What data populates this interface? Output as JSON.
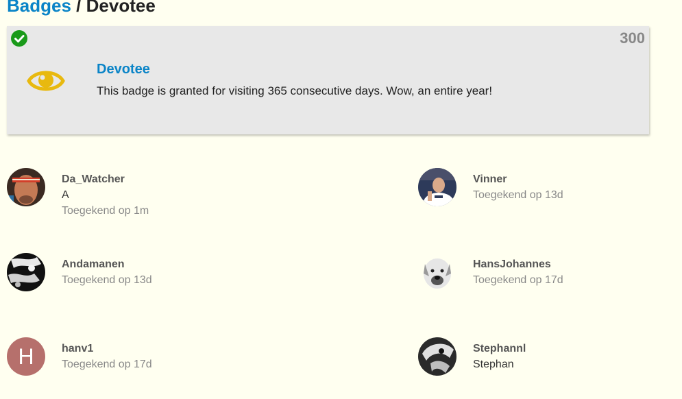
{
  "breadcrumb": {
    "parent": "Badges",
    "separator": "/",
    "current": "Devotee"
  },
  "badge": {
    "name": "Devotee",
    "description": "This badge is granted for visiting 365 consecutive days. Wow, an entire year!",
    "granted_count": "300",
    "icon": "eye-icon",
    "icon_color": "#e8b90f",
    "status_icon": "check-circle-icon",
    "status_color": "#1a9a1a"
  },
  "users": [
    {
      "username": "Da_Watcher",
      "title": "A",
      "granted": "Toegekend op 1m"
    },
    {
      "username": "Vinner",
      "title": "",
      "granted": "Toegekend op 13d"
    },
    {
      "username": "Andamanen",
      "title": "",
      "granted": "Toegekend op 13d"
    },
    {
      "username": "HansJohannes",
      "title": "",
      "granted": "Toegekend op 17d"
    },
    {
      "username": "hanv1",
      "title": "",
      "granted": "Toegekend op 17d",
      "avatar_letter": "H"
    },
    {
      "username": "Stephannl",
      "title": "Stephan",
      "granted": ""
    }
  ]
}
